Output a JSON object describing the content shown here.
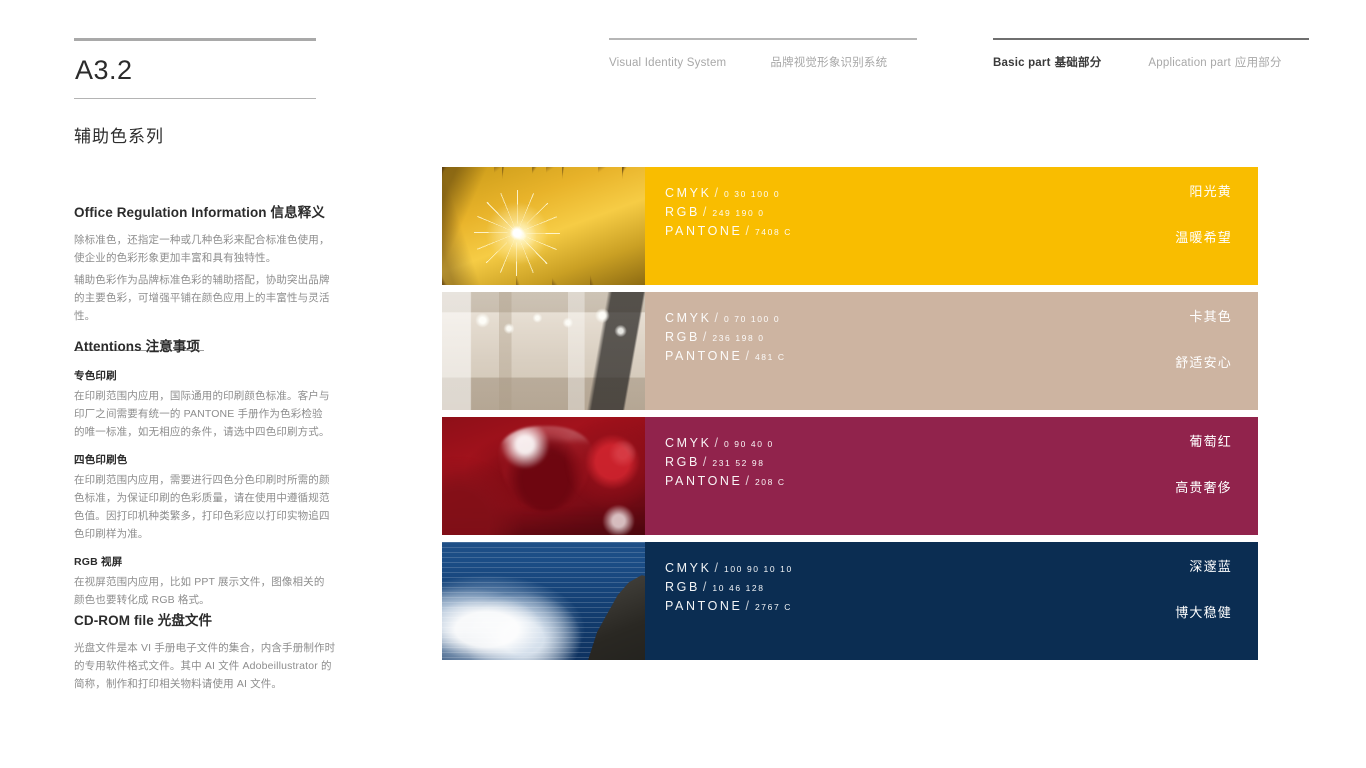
{
  "page": {
    "code": "A3.2",
    "section_title": "辅助色系列"
  },
  "nav": {
    "left": [
      {
        "en": "Visual Identity System",
        "cn": ""
      },
      {
        "en": "",
        "cn": "品牌视觉形象识别系统"
      }
    ],
    "right": [
      {
        "en": "Basic part",
        "cn": "基础部分",
        "active": true
      },
      {
        "en": "Application part",
        "cn": "应用部分",
        "active": false
      }
    ]
  },
  "sidebar": {
    "office": {
      "heading_en": "Office Regulation Information",
      "heading_cn": "信息释义",
      "paragraph1": "除标准色，还指定一种或几种色彩来配合标准色使用，使企业的色彩形象更加丰富和具有独特性。",
      "paragraph2": "辅助色彩作为品牌标准色彩的辅助搭配，协助突出品牌的主要色彩，可增强平铺在颜色应用上的丰富性与灵活性。"
    },
    "attentions": {
      "heading_en": "Attentions",
      "heading_cn": "注意事项",
      "items": [
        {
          "subhead": "专色印刷",
          "body": "在印刷范围内应用，国际通用的印刷颜色标准。客户与印厂之间需要有统一的 PANTONE 手册作为色彩检验的唯一标准，如无相应的条件，请选中四色印刷方式。"
        },
        {
          "subhead": "四色印刷色",
          "body": "在印刷范围内应用，需要进行四色分色印刷时所需的颜色标准，为保证印刷的色彩质量，请在使用中遵循规范色值。因打印机种类繁多，打印色彩应以打印实物追四色印刷样为准。"
        },
        {
          "subhead": "RGB 视屏",
          "body": "在视屏范围内应用，比如 PPT 展示文件，图像相关的颜色也要转化成 RGB 格式。"
        }
      ]
    },
    "cdrom": {
      "heading_en": "CD-ROM file",
      "heading_cn": "光盘文件",
      "body": "光盘文件是本 VI 手册电子文件的集合，内含手册制作时的专用软件格式文件。其中 AI 文件 Adobeillustrator 的简称，制作和打印相关物料请使用 AI 文件。"
    }
  },
  "labels": {
    "cmyk": "CMYK",
    "rgb": "RGB",
    "pantone": "PANTONE",
    "slash": "/"
  },
  "swatches": [
    {
      "name_cn": "阳光黄",
      "name_sub": "温暖希望",
      "hex": "#f9bd00",
      "cmyk": "0  30  100  0",
      "rgb": "249  190  0",
      "pantone": "7408 C",
      "photo": "autumn-trees-sunburst"
    },
    {
      "name_cn": "卡其色",
      "name_sub": "舒适安心",
      "hex": "#cdb4a1",
      "cmyk": "0  70  100  0",
      "rgb": "236  198  0",
      "pantone": "481 C",
      "photo": "beige-interior-room"
    },
    {
      "name_cn": "葡萄红",
      "name_sub": "高贵奢侈",
      "hex": "#91234c",
      "cmyk": "0  90  40  0",
      "rgb": "231  52  98",
      "pantone": "208 C",
      "photo": "red-wine-glass"
    },
    {
      "name_cn": "深邃蓝",
      "name_sub": "博大稳健",
      "hex": "#0b2d52",
      "cmyk": "100  90  10  10",
      "rgb": "10  46  128",
      "pantone": "2767 C",
      "photo": "ocean-waves-rocks"
    }
  ]
}
